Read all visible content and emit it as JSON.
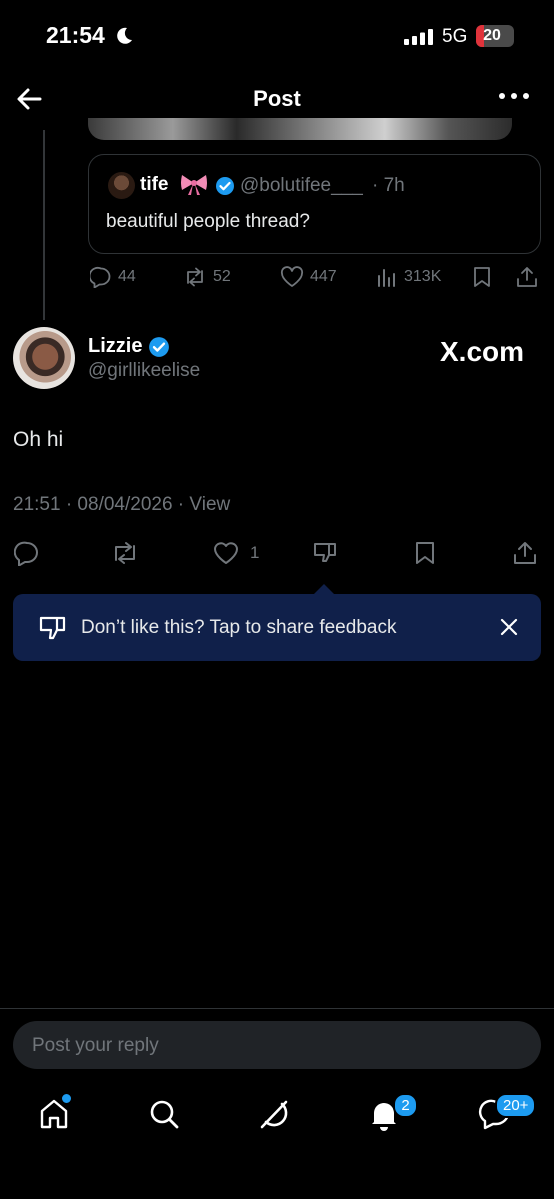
{
  "status_bar": {
    "time": "21:54",
    "network": "5G",
    "battery": "20",
    "battery_level": 0.2
  },
  "header": {
    "title": "Post"
  },
  "quoted_post": {
    "name": "tife",
    "handle": "@bolutifee___",
    "time": "· 7h",
    "text": "beautiful people thread?",
    "metrics": {
      "replies": "44",
      "reposts": "52",
      "likes": "447",
      "views": "313K"
    }
  },
  "post": {
    "name": "Lizzie",
    "handle": "@girllikeelise",
    "source_label": "X.com",
    "text": "Oh hi",
    "meta": "21:51 · 08/04/2026 · View",
    "likes": "1"
  },
  "feedback_toast": {
    "text": "Don’t like this? Tap to share feedback"
  },
  "reply": {
    "placeholder": "Post your reply"
  },
  "tab_bar": {
    "notifications_badge": "2",
    "messages_badge": "20+"
  },
  "colors": {
    "accent": "#1d9bf0",
    "toast_bg": "#10204a",
    "muted": "#71767b",
    "battery_low": "#e0333b"
  }
}
